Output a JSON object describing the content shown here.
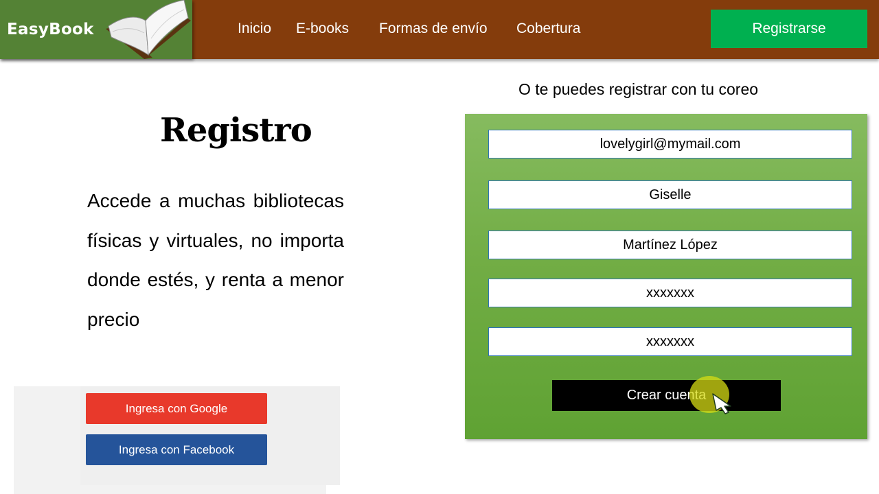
{
  "header": {
    "brand": "EasyBook",
    "nav": [
      "Inicio",
      "E-books",
      "Formas de envío",
      "Cobertura"
    ],
    "register_label": "Registrarse"
  },
  "main": {
    "title": "Registro",
    "description": "Accede a muchas bibliotecas físicas y virtuales, no importa donde estés, y renta a menor precio",
    "google_label": "Ingresa con Google",
    "facebook_label": "Ingresa con Facebook"
  },
  "form": {
    "caption": "O te puedes registrar con tu coreo",
    "fields": [
      "lovelygirl@mymail.com",
      "Giselle",
      "Martínez López",
      "xxxxxxx",
      "xxxxxxx"
    ],
    "submit_label": "Crear cuenta"
  },
  "colors": {
    "header_bg": "#843c0c",
    "brand_bg": "#548235",
    "register_bg": "#00b050",
    "google": "#e8392b",
    "facebook": "#25549a",
    "form_panel": "#70ad47"
  },
  "icons": [
    "open-book-icon",
    "pointer-cursor-icon"
  ]
}
